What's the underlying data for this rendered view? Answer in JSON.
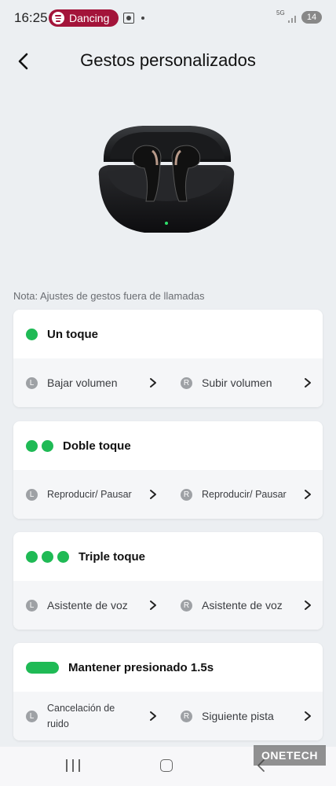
{
  "status_bar": {
    "time": "16:25",
    "media": "Dancing",
    "network": "5G",
    "battery": "14"
  },
  "header": {
    "title": "Gestos personalizados"
  },
  "note": "Nota: Ajustes de gestos fuera de llamadas",
  "side_badges": {
    "left": "L",
    "right": "R"
  },
  "gestures": [
    {
      "title": "Un toque",
      "left_action": "Bajar volumen",
      "right_action": "Subir volumen"
    },
    {
      "title": "Doble toque",
      "left_action": "Reproducir/ Pausar",
      "right_action": "Reproducir/ Pausar"
    },
    {
      "title": "Triple toque",
      "left_action": "Asistente de voz",
      "right_action": "Asistente de voz"
    },
    {
      "title": "Mantener presionado 1.5s",
      "left_action": "Cancelación de ruido",
      "right_action": "Siguiente pista"
    }
  ],
  "watermark": "ONETECH",
  "colors": {
    "accent_green": "#1fba55",
    "spotify_pill": "#a3143a",
    "background": "#eceff2"
  },
  "icons": [
    "back-arrow-icon",
    "spotify-icon",
    "screenshot-icon",
    "signal-icon",
    "chevron-right-icon",
    "recents-icon",
    "home-icon",
    "nav-back-icon"
  ]
}
